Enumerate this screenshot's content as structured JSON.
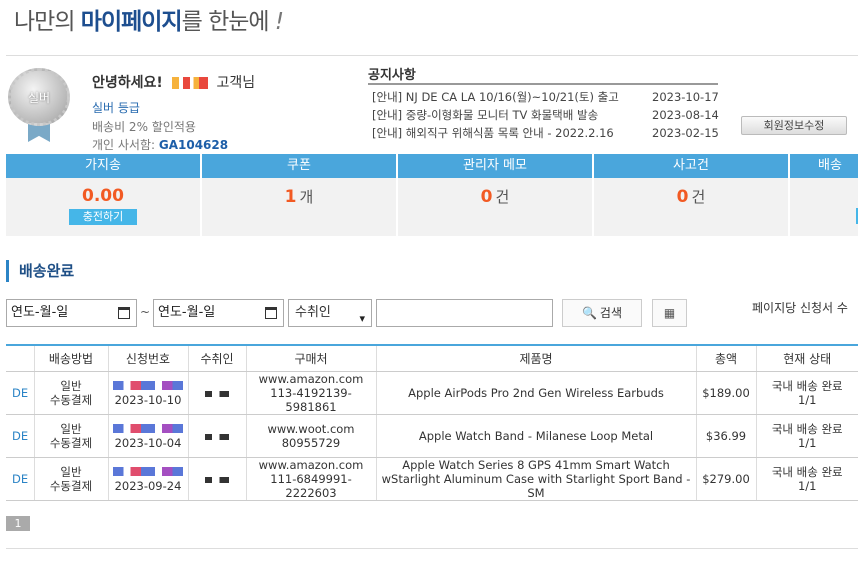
{
  "hero": {
    "prefix": "나만의 ",
    "highlight": "마이페이지",
    "suffix": "를 한눈에",
    "excl": "!"
  },
  "member": {
    "medal_label": "실버",
    "greeting": "안녕하세요!",
    "honorific": "고객님",
    "grade": "실버 등급",
    "benefit": "배송비 2% 할인적용",
    "pobox_label": "개인 사서함: ",
    "pobox_id": "GA104628"
  },
  "notice": {
    "title": "공지사항",
    "items": [
      {
        "text": "[안내] NJ DE CA LA 10/16(월)~10/21(토) 출고",
        "date": "2023-10-17"
      },
      {
        "text": "[안내] 중량-이형화물 모니터 TV 화물택배 발송",
        "date": "2023-08-14"
      },
      {
        "text": "[안내] 해외직구 위해식품 목록 안내 - 2022.2.16",
        "date": "2023-02-15"
      }
    ]
  },
  "edit_profile_label": "회원정보수정",
  "stats": [
    {
      "label": "가지송",
      "value": "0.00",
      "unit": "",
      "action": "충전하기"
    },
    {
      "label": "쿠폰",
      "value": "1",
      "unit": "개"
    },
    {
      "label": "관리자 메모",
      "value": "0",
      "unit": "건"
    },
    {
      "label": "사고건",
      "value": "0",
      "unit": "건"
    },
    {
      "label": "배송"
    }
  ],
  "section_title": "배송완료",
  "filter": {
    "date_from": "연도-월-일",
    "tilde": "~",
    "date_to": "연도-월-일",
    "select_value": "수취인",
    "search_label": "검색",
    "perpage_label": "페이지당 신청서 수"
  },
  "table": {
    "headers": [
      "",
      "배송방법",
      "신청번호",
      "수취인",
      "구매처",
      "제품명",
      "총액",
      "현재 상태"
    ],
    "rows": [
      {
        "center": "DE",
        "method1": "일반",
        "method2": "수동결제",
        "date": "2023-10-10",
        "store1": "www.amazon.com",
        "store2": "113-4192139-5981861",
        "product": "Apple AirPods Pro 2nd Gen Wireless Earbuds",
        "total": "$189.00",
        "status1": "국내 배송 완료",
        "status2": "1/1"
      },
      {
        "center": "DE",
        "method1": "일반",
        "method2": "수동결제",
        "date": "2023-10-04",
        "store1": "www.woot.com",
        "store2": "80955729",
        "product": "Apple Watch Band - Milanese Loop Metal",
        "total": "$36.99",
        "status1": "국내 배송 완료",
        "status2": "1/1"
      },
      {
        "center": "DE",
        "method1": "일반",
        "method2": "수동결제",
        "date": "2023-09-24",
        "store1": "www.amazon.com",
        "store2": "111-6849991-2222603",
        "product": "Apple Watch Series 8 GPS 41mm Smart Watch wStarlight Aluminum Case with Starlight Sport Band - SM",
        "total": "$279.00",
        "status1": "국내 배송 완료",
        "status2": "1/1"
      }
    ]
  },
  "pager": {
    "current": "1"
  }
}
